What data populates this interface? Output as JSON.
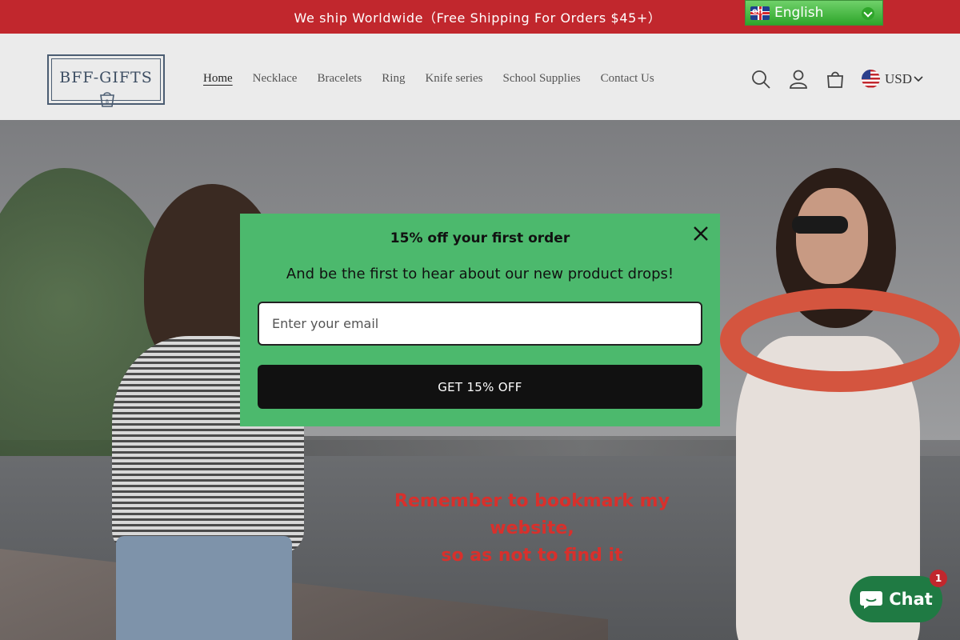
{
  "announcement": {
    "text": "We ship Worldwide（Free Shipping For Orders $45+）",
    "bg_color": "#c1272d"
  },
  "language_selector": {
    "label": "English",
    "flag_icon": "uk-flag-icon"
  },
  "header": {
    "logo_text": "BFF-GIFTS",
    "nav": [
      {
        "label": "Home",
        "active": true
      },
      {
        "label": "Necklace",
        "active": false
      },
      {
        "label": "Bracelets",
        "active": false
      },
      {
        "label": "Ring",
        "active": false
      },
      {
        "label": "Knife series",
        "active": false
      },
      {
        "label": "School Supplies",
        "active": false
      },
      {
        "label": "Contact Us",
        "active": false
      }
    ],
    "icons": [
      "search-icon",
      "account-icon",
      "cart-icon"
    ],
    "currency": "USD"
  },
  "hero": {
    "note_line1": "Remember to bookmark my website,",
    "note_line2": "so as not to find it"
  },
  "popup": {
    "title": "15% off your first order",
    "subtitle": "And be the first to hear about our new product drops!",
    "email_placeholder": "Enter your email",
    "email_value": "",
    "button_label": "GET 15% OFF",
    "bg_color": "#4cb96d"
  },
  "chat": {
    "label": "Chat",
    "badge_count": "1",
    "bg_color": "#1f7a43"
  }
}
